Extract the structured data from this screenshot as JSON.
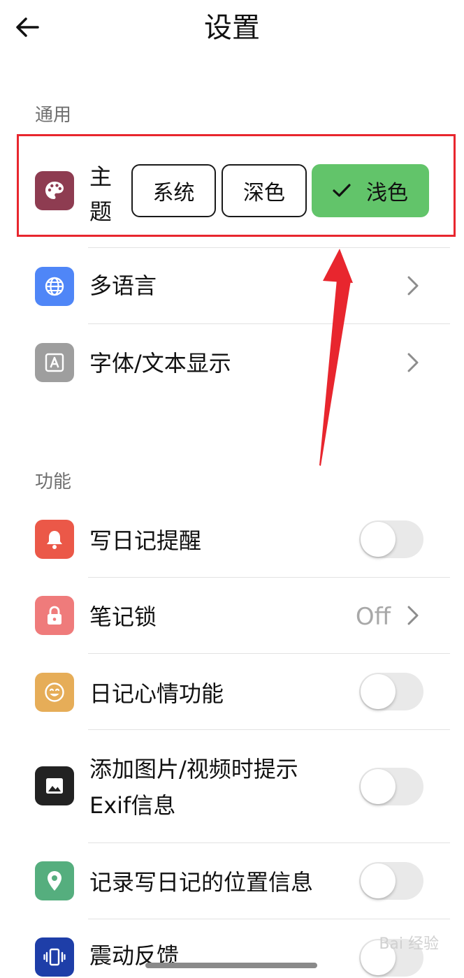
{
  "header": {
    "title": "设置",
    "back_icon": "arrow-left-icon"
  },
  "sections": {
    "general": {
      "title": "通用"
    },
    "features": {
      "title": "功能"
    }
  },
  "theme": {
    "label": "主题",
    "icon": "palette-icon",
    "icon_color": "#8e3c51",
    "options": [
      "系统",
      "深色",
      "浅色"
    ],
    "selected": "浅色",
    "selected_color": "#62c46a"
  },
  "general_items": [
    {
      "label": "多语言",
      "icon": "globe-icon",
      "icon_color": "#4f86f7"
    },
    {
      "label": "字体/文本显示",
      "icon": "font-icon",
      "icon_color": "#9e9e9e"
    }
  ],
  "feature_items": [
    {
      "label": "写日记提醒",
      "icon": "bell-icon",
      "icon_color": "#eb5848",
      "toggle": false
    },
    {
      "label": "笔记锁",
      "icon": "lock-icon",
      "icon_color": "#ef7b7b",
      "value": "Off"
    },
    {
      "label": "日记心情功能",
      "icon": "smile-icon",
      "icon_color": "#e6ad58",
      "toggle": false
    },
    {
      "label_line1": "添加图片/视频时提示",
      "label_line2": "Exif信息",
      "icon": "image-icon",
      "icon_color": "#222222",
      "toggle": false
    },
    {
      "label": "记录写日记的位置信息",
      "icon": "location-pin-icon",
      "icon_color": "#55ae7e",
      "toggle": false
    },
    {
      "label": "震动反馈",
      "icon": "vibration-icon",
      "icon_color": "#1e3ea8",
      "toggle": false
    }
  ],
  "annotation": {
    "color": "#e8262e"
  },
  "watermark": "Bai 经验"
}
